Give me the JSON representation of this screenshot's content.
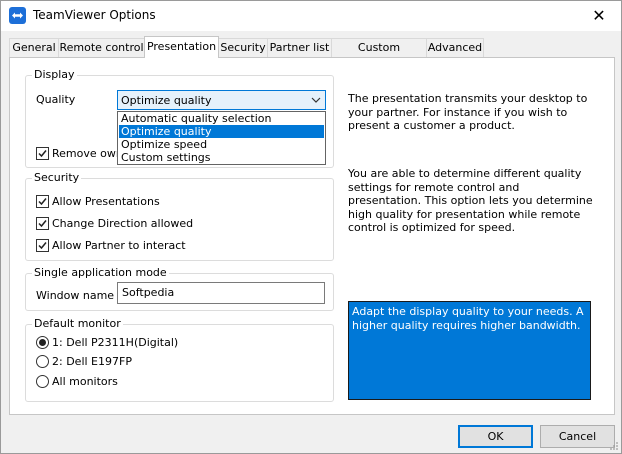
{
  "window": {
    "title": "TeamViewer Options",
    "close_glyph": "✕",
    "icon": "teamviewer-logo-icon"
  },
  "tabs": [
    {
      "label": "General"
    },
    {
      "label": "Remote control"
    },
    {
      "label": "Presentation",
      "active": true
    },
    {
      "label": "Security"
    },
    {
      "label": "Partner list"
    },
    {
      "label": "Custom invitation"
    },
    {
      "label": "Advanced"
    }
  ],
  "display": {
    "legend": "Display",
    "quality_label": "Quality",
    "quality_value": "Optimize quality",
    "quality_options": [
      "Automatic quality selection",
      "Optimize quality",
      "Optimize speed",
      "Custom settings"
    ],
    "selected_option_index": 1,
    "remove_wallpaper_label": "Remove own",
    "remove_wallpaper_checked": true
  },
  "security": {
    "legend": "Security",
    "items": [
      {
        "label": "Allow Presentations",
        "checked": true
      },
      {
        "label": "Change Direction allowed",
        "checked": true
      },
      {
        "label": "Allow Partner to interact",
        "checked": true
      }
    ]
  },
  "single_app": {
    "legend": "Single application mode",
    "window_name_label": "Window name",
    "window_name_value": "Softpedia"
  },
  "default_monitor": {
    "legend": "Default monitor",
    "options": [
      {
        "label": "1: Dell P2311H(Digital)",
        "selected": true
      },
      {
        "label": "2: Dell E197FP",
        "selected": false
      },
      {
        "label": "All monitors",
        "selected": false
      }
    ]
  },
  "info": {
    "paragraph1": "The presentation transmits your desktop to your partner. For instance if you wish to present a customer a product.",
    "paragraph2": "You are able to determine different quality settings for remote control and presentation. This option lets you determine high quality for presentation while remote control is optimized for speed.",
    "hint": "Adapt the display quality to your needs. A higher quality requires higher bandwidth."
  },
  "buttons": {
    "ok": "OK",
    "cancel": "Cancel"
  },
  "colors": {
    "accent": "#0078d7",
    "hint_bg": "#0078d7",
    "panel_bg": "#ffffff",
    "window_bg": "#f0f0f0"
  }
}
